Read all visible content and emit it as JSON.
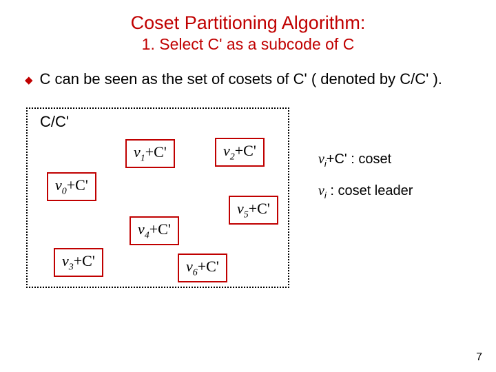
{
  "title": "Coset Partitioning Algorithm:",
  "subtitle": "1. Select C' as a subcode of C",
  "bullet": "C can be seen as the set of cosets of C' ( denoted by C/C' ).",
  "diagram": {
    "label": "C/C'",
    "cosets": {
      "c0": "+C'",
      "c1": "+C'",
      "c2": "+C'",
      "c3": "+C'",
      "c4": "+C'",
      "c5": "+C'",
      "c6": "+C'"
    },
    "subs": {
      "s0": "0",
      "s1": "1",
      "s2": "2",
      "s3": "3",
      "s4": "4",
      "s5": "5",
      "s6": "6"
    }
  },
  "legend": {
    "coset_suffix": "+C' : coset",
    "leader_suffix": " : coset leader",
    "isub": "i"
  },
  "v": "v",
  "page": "7"
}
